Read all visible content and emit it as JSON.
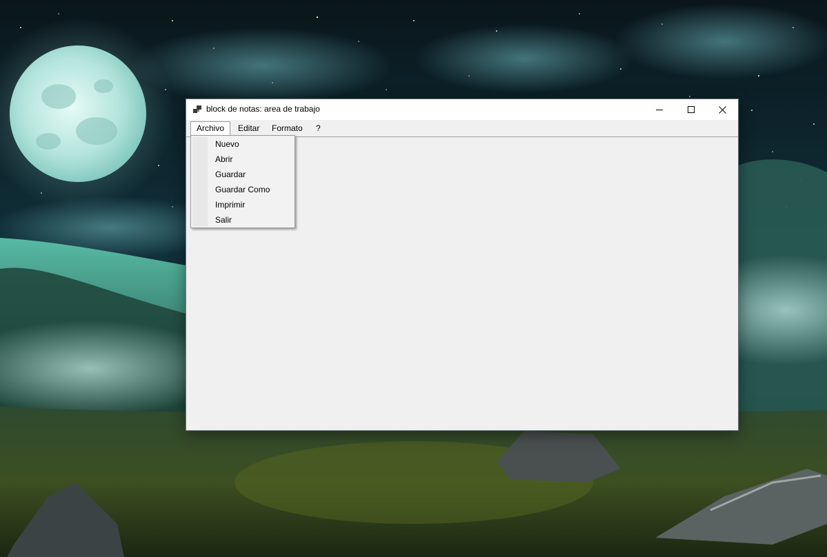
{
  "window": {
    "title": "block de notas: area de trabajo"
  },
  "menubar": {
    "items": [
      {
        "label": "Archivo",
        "open": true
      },
      {
        "label": "Editar"
      },
      {
        "label": "Formato"
      },
      {
        "label": "?"
      }
    ]
  },
  "dropdown": {
    "items": [
      {
        "label": "Nuevo"
      },
      {
        "label": "Abrir"
      },
      {
        "label": "Guardar"
      },
      {
        "label": "Guardar Como"
      },
      {
        "label": "Imprimir"
      },
      {
        "label": "Salir"
      }
    ]
  },
  "icons": {
    "app": "app-window-icon",
    "minimize": "minimize-icon",
    "maximize": "maximize-icon",
    "close": "close-icon"
  },
  "colors": {
    "titlebar": "#ffffff",
    "client": "#f0f0f0",
    "menu_open_bg": "#ffffff",
    "dropdown_bg": "#f2f2f2"
  }
}
